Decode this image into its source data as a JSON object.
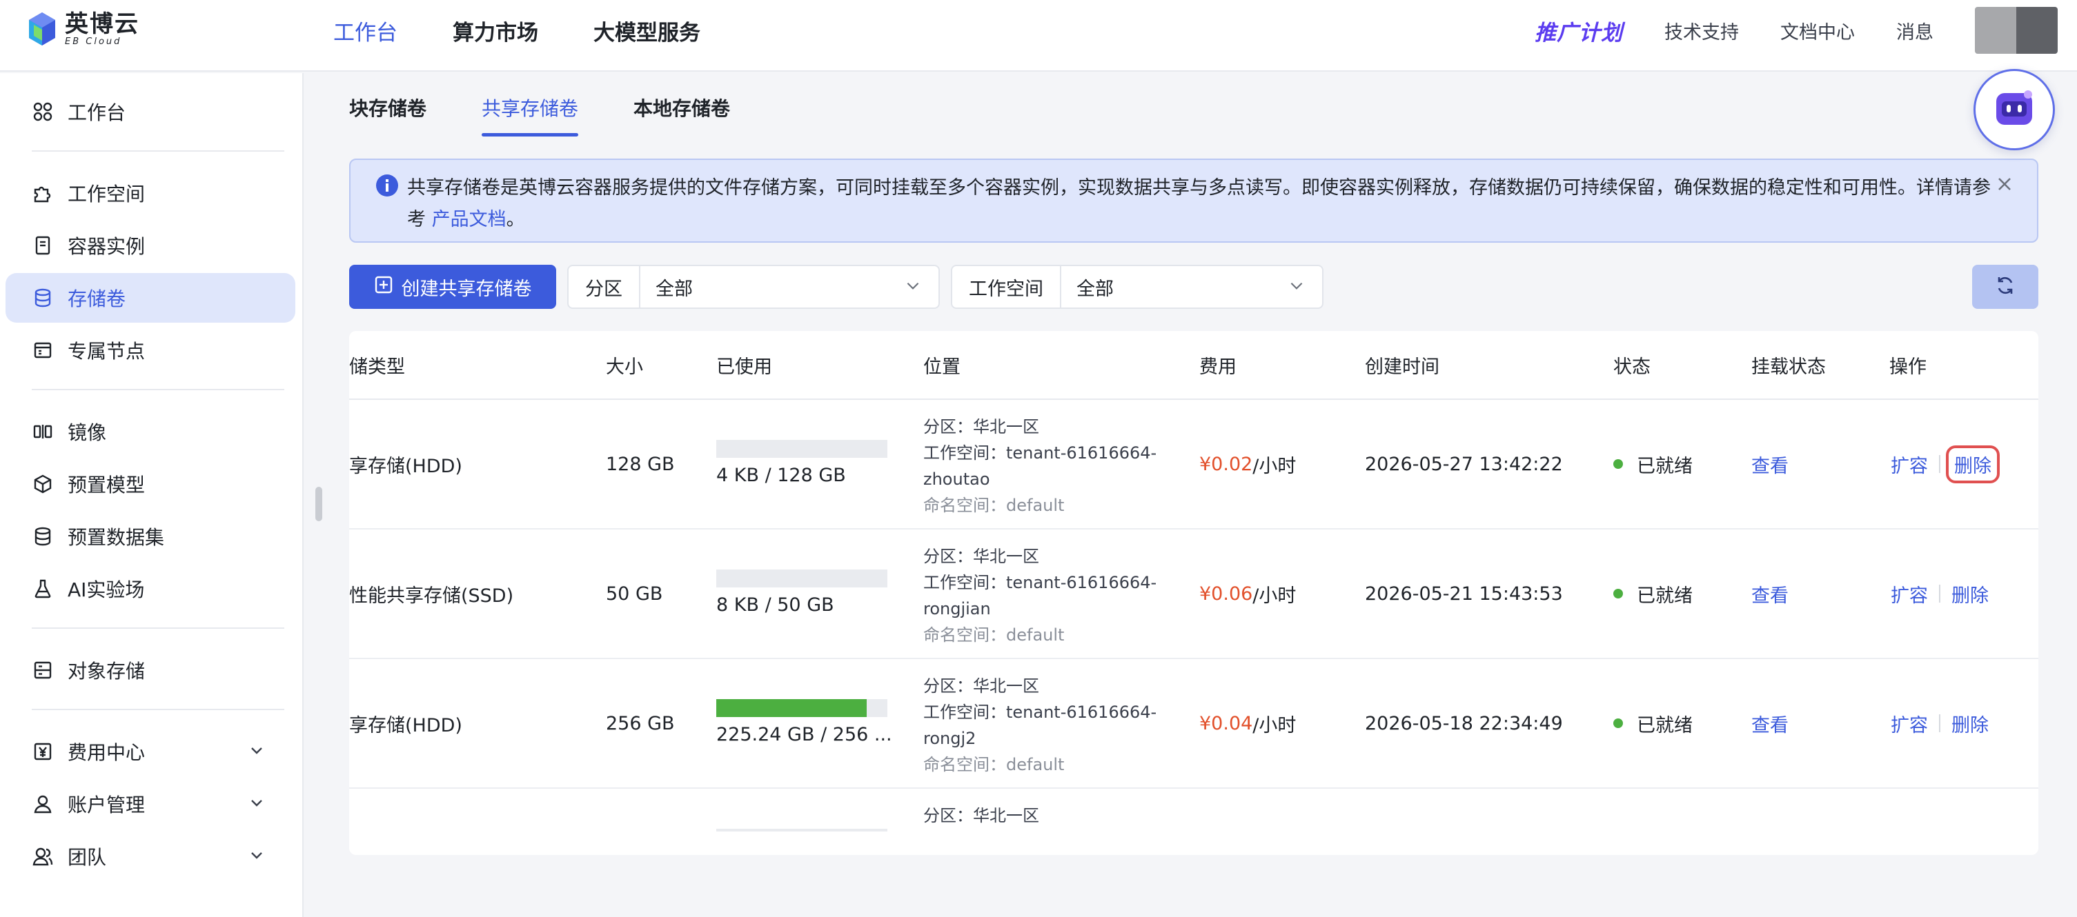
{
  "brand": {
    "name_cn": "英博云",
    "name_en": "EB Cloud"
  },
  "topnav": {
    "items": [
      "工作台",
      "算力市场",
      "大模型服务"
    ]
  },
  "topright": {
    "promo": "推广计划",
    "links": [
      "技术支持",
      "文档中心",
      "消息"
    ]
  },
  "sidebar": {
    "items": [
      {
        "label": "工作台",
        "icon": "grid-icon"
      },
      {
        "label": "工作空间",
        "icon": "puzzle-icon"
      },
      {
        "label": "容器实例",
        "icon": "server-icon"
      },
      {
        "label": "存储卷",
        "icon": "database-icon"
      },
      {
        "label": "专属节点",
        "icon": "node-icon"
      },
      {
        "label": "镜像",
        "icon": "mirror-icon"
      },
      {
        "label": "预置模型",
        "icon": "cube-icon"
      },
      {
        "label": "预置数据集",
        "icon": "dataset-icon"
      },
      {
        "label": "AI实验场",
        "icon": "flask-icon"
      },
      {
        "label": "对象存储",
        "icon": "bucket-icon"
      },
      {
        "label": "费用中心",
        "icon": "yen-icon"
      },
      {
        "label": "账户管理",
        "icon": "user-icon"
      },
      {
        "label": "团队",
        "icon": "team-icon"
      }
    ],
    "active": "存储卷"
  },
  "tabs": [
    "块存储卷",
    "共享存储卷",
    "本地存储卷"
  ],
  "notice": {
    "text": "共享存储卷是英博云容器服务提供的文件存储方案，可同时挂载至多个容器实例，实现数据共享与多点读写。即使容器实例释放，存储数据仍可持续保留，确保数据的稳定性和可用性。详情请参考 ",
    "link": "产品文档",
    "end": "。"
  },
  "toolbar": {
    "create_label": "创建共享存储卷",
    "partition_label": "分区",
    "partition_value": "全部",
    "workspace_label": "工作空间",
    "workspace_value": "全部"
  },
  "table": {
    "headers": [
      "储类型",
      "大小",
      "已使用",
      "位置",
      "费用",
      "创建时间",
      "状态",
      "挂载状态",
      "操作"
    ],
    "rows": [
      {
        "type": "享存储(HDD)",
        "size": "128 GB",
        "used": "4 KB / 128 GB",
        "used_fraction": 0,
        "partition": "分区：华北一区",
        "workspace": "工作空间：tenant-61616664-zhoutao",
        "namespace": "命名空间：default",
        "price": "¥0.02",
        "price_unit": " /小时",
        "created": "2026-05-27 13:42:22",
        "status": "已就绪",
        "mount": "查看",
        "op_expand": "扩容",
        "op_delete": "删除"
      },
      {
        "type": "性能共享存储(SSD)",
        "size": "50 GB",
        "used": "8 KB / 50 GB",
        "used_fraction": 0,
        "partition": "分区：华北一区",
        "workspace": "工作空间：tenant-61616664-rongjian",
        "namespace": "命名空间：default",
        "price": "¥0.06",
        "price_unit": " /小时",
        "created": "2026-05-21 15:43:53",
        "status": "已就绪",
        "mount": "查看",
        "op_expand": "扩容",
        "op_delete": "删除"
      },
      {
        "type": "享存储(HDD)",
        "size": "256 GB",
        "used": "225.24 GB / 256 ...",
        "used_fraction": 0.88,
        "partition": "分区：华北一区",
        "workspace": "工作空间：tenant-61616664-rongj2",
        "namespace": "命名空间：default",
        "price": "¥0.04",
        "price_unit": " /小时",
        "created": "2026-05-18 22:34:49",
        "status": "已就绪",
        "mount": "查看",
        "op_expand": "扩容",
        "op_delete": "删除"
      },
      {
        "partition": "分区：华北一区"
      }
    ]
  },
  "colors": {
    "accent": "#3c5bdc",
    "price": "#e2502b",
    "ready": "#4caf40",
    "danger": "#e05050"
  }
}
